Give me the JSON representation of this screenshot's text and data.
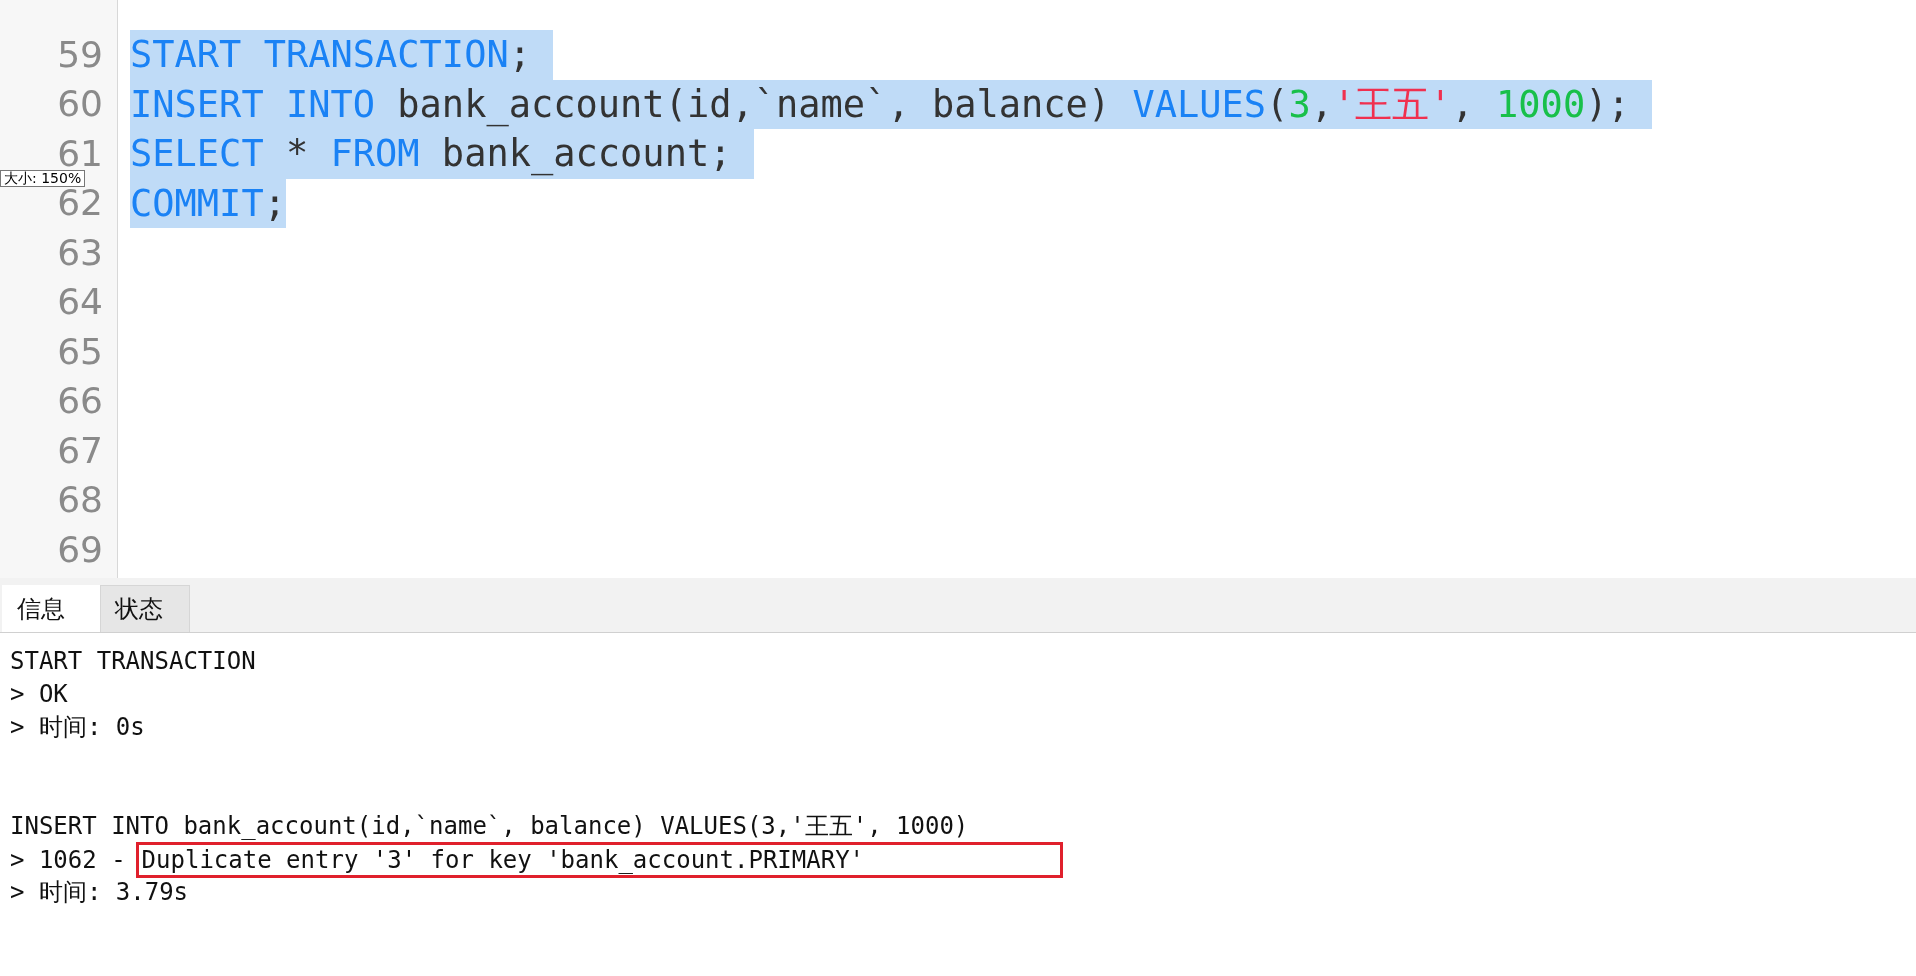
{
  "editor": {
    "lines": [
      {
        "number": "59",
        "selected": true,
        "tokens": [
          {
            "kind": "keyword",
            "text": "START TRANSACTION"
          },
          {
            "kind": "plain",
            "text": "; "
          }
        ]
      },
      {
        "number": "60",
        "selected": true,
        "tokens": [
          {
            "kind": "keyword",
            "text": "INSERT INTO"
          },
          {
            "kind": "plain",
            "text": " bank_account(id,`name`, balance) "
          },
          {
            "kind": "keyword",
            "text": "VALUES"
          },
          {
            "kind": "plain",
            "text": "("
          },
          {
            "kind": "number",
            "text": "3"
          },
          {
            "kind": "plain",
            "text": ","
          },
          {
            "kind": "string",
            "text": "'王五'"
          },
          {
            "kind": "plain",
            "text": ", "
          },
          {
            "kind": "number",
            "text": "1000"
          },
          {
            "kind": "plain",
            "text": "); "
          }
        ]
      },
      {
        "number": "61",
        "selected": true,
        "tokens": [
          {
            "kind": "keyword",
            "text": "SELECT"
          },
          {
            "kind": "plain",
            "text": " * "
          },
          {
            "kind": "keyword",
            "text": "FROM"
          },
          {
            "kind": "plain",
            "text": " bank_account; "
          }
        ]
      },
      {
        "number": "62",
        "selected": true,
        "tokens": [
          {
            "kind": "keyword",
            "text": "COMMIT"
          },
          {
            "kind": "plain",
            "text": ";"
          }
        ]
      },
      {
        "number": "63",
        "selected": false
      },
      {
        "number": "64",
        "selected": false
      },
      {
        "number": "65",
        "selected": false
      },
      {
        "number": "66",
        "selected": false
      },
      {
        "number": "67",
        "selected": false
      },
      {
        "number": "68",
        "selected": false
      },
      {
        "number": "69",
        "selected": false
      }
    ]
  },
  "zoom_tooltip": "大小: 150%",
  "tabs": [
    {
      "label": "信息",
      "selected": true
    },
    {
      "label": "状态",
      "selected": false
    }
  ],
  "output": {
    "blocks": [
      {
        "lines": [
          {
            "kind": "text",
            "text": "START TRANSACTION"
          },
          {
            "kind": "text",
            "text": "> OK"
          },
          {
            "kind": "text",
            "text": "> 时间: 0s"
          }
        ]
      },
      {
        "lines": [
          {
            "kind": "text",
            "text": "INSERT INTO bank_account(id,`name`, balance) VALUES(3,'王五', 1000)"
          },
          {
            "kind": "error",
            "text": "> 1062 -",
            "message": "Duplicate entry '3' for key 'bank_account.PRIMARY'"
          },
          {
            "kind": "text",
            "text": "> 时间: 3.79s"
          }
        ]
      }
    ]
  }
}
